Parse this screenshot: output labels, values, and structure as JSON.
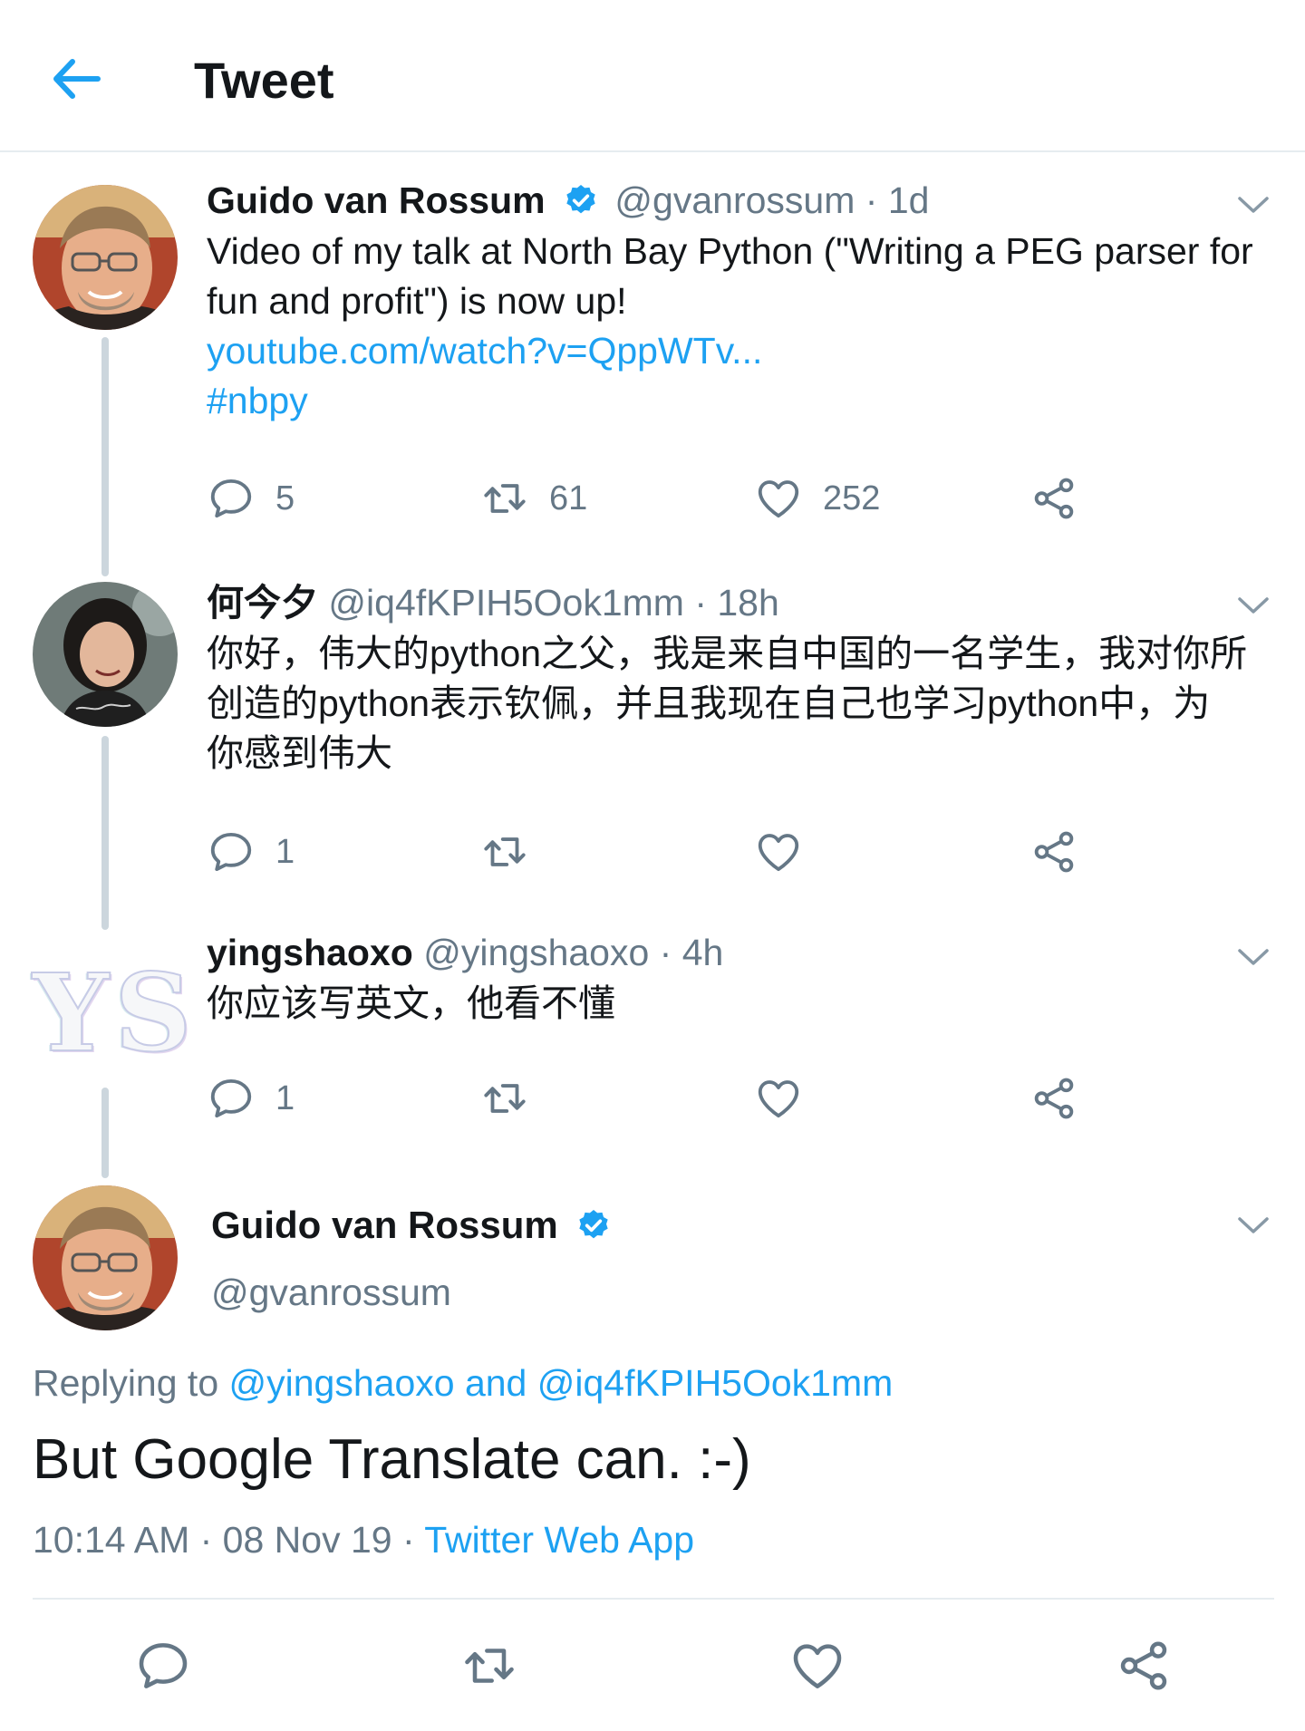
{
  "header": {
    "title": "Tweet"
  },
  "colors": {
    "accent": "#1da1f2",
    "muted": "#657786",
    "text": "#14171a",
    "line": "#ccd6dd"
  },
  "tweets": [
    {
      "name": "Guido van Rossum",
      "verified": true,
      "handle": "@gvanrossum",
      "sep": " · ",
      "time": "1d",
      "text_lines": [
        "Video of my talk at North Bay Python (\"Writing a PEG parser for",
        "fun and profit\") is now up!"
      ],
      "link": "youtube.com/watch?v=QppWTv...",
      "hashtag": "#nbpy",
      "actions": {
        "replies": "5",
        "retweets": "61",
        "likes": "252"
      }
    },
    {
      "name": "何今夕",
      "handle": "@iq4fKPIH5Ook1mm",
      "sep": " · ",
      "time": "18h",
      "text_lines": [
        "你好，伟大的python之父，我是来自中国的一名学生，我对你所",
        "创造的python表示钦佩，并且我现在自己也学习python中，为",
        "你感到伟大"
      ],
      "actions": {
        "replies": "1"
      }
    },
    {
      "name": "yingshaoxo",
      "handle": "@yingshaoxo",
      "sep": " · ",
      "time": "4h",
      "avatar_text": "YS",
      "text_lines": [
        "你应该写英文，他看不懂"
      ],
      "actions": {
        "replies": "1"
      }
    }
  ],
  "main": {
    "name": "Guido van Rossum",
    "handle": "@gvanrossum",
    "replying_prefix": "Replying to ",
    "mention1": "@yingshaoxo",
    "and": " and ",
    "mention2": "@iq4fKPIH5Ook1mm",
    "text": "But Google Translate can. :-)",
    "time": "10:14 AM · 08 Nov 19 · ",
    "source": "Twitter Web App"
  },
  "icons": [
    "back-arrow-icon",
    "verified-icon",
    "chevron-down-icon",
    "reply-icon",
    "retweet-icon",
    "like-icon",
    "share-icon"
  ]
}
